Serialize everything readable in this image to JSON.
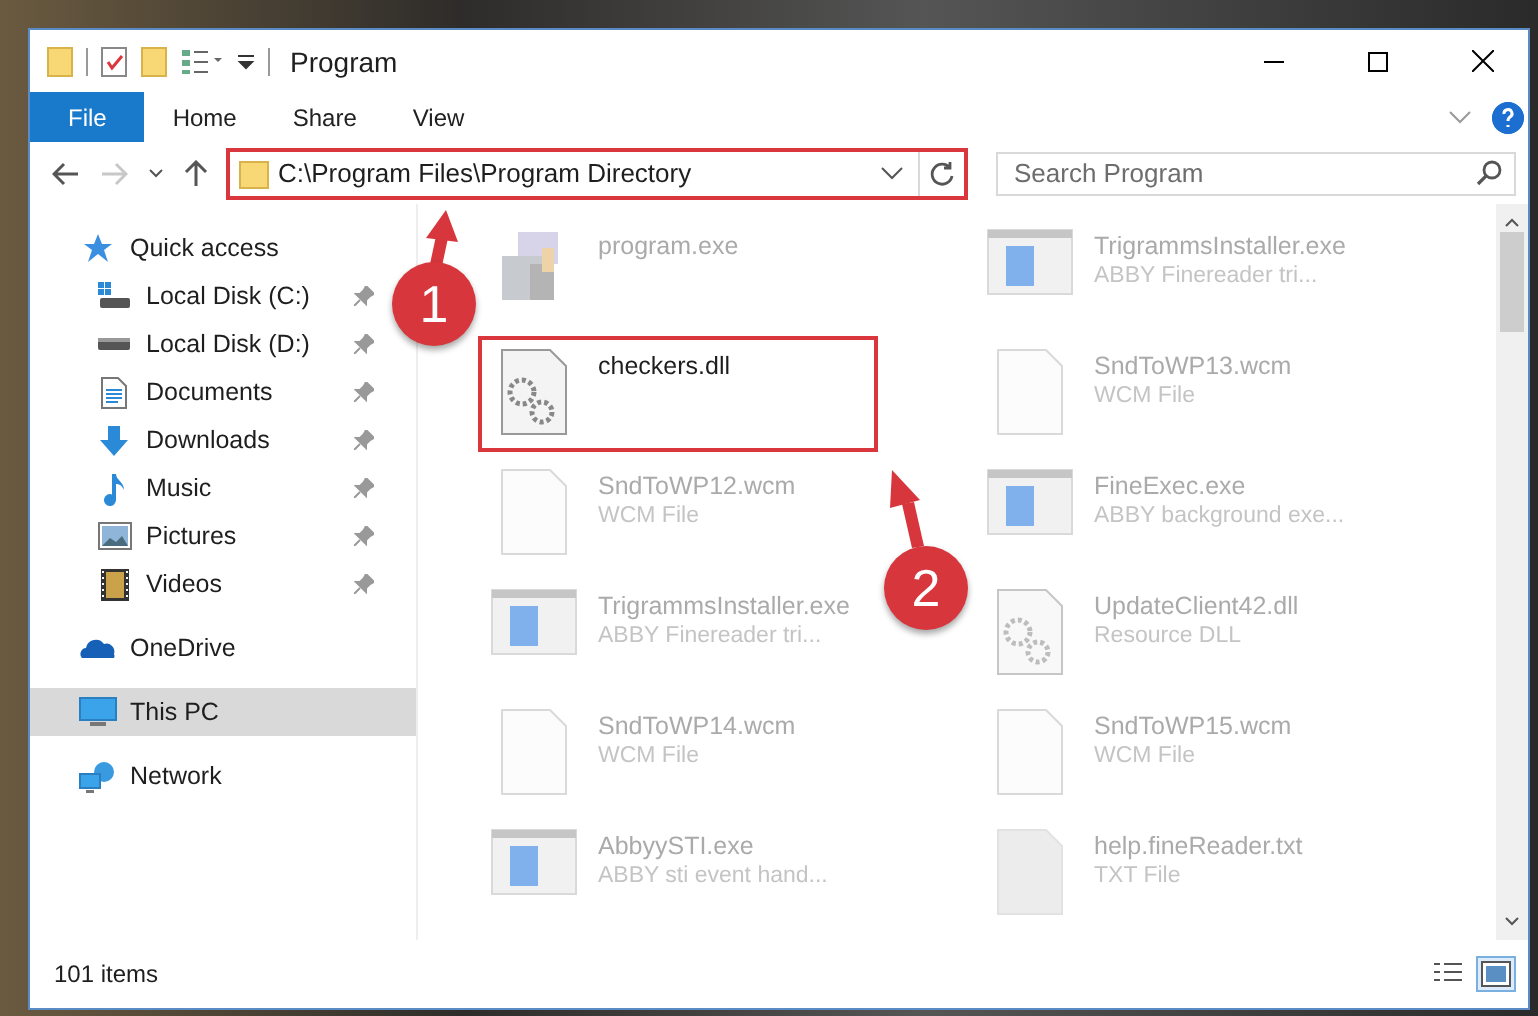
{
  "window": {
    "title": "Program"
  },
  "ribbon_tabs": [
    {
      "label": "File",
      "kind": "file"
    },
    {
      "label": "Home",
      "kind": "tab"
    },
    {
      "label": "Share",
      "kind": "tab"
    },
    {
      "label": "View",
      "kind": "tab"
    }
  ],
  "address_bar": {
    "path": "C:\\Program Files\\Program Directory",
    "highlighted": true
  },
  "search": {
    "placeholder": "Search Program"
  },
  "nav_pane": {
    "items": [
      {
        "label": "Quick access",
        "kind": "star",
        "selected": false,
        "pinned": false,
        "children": [
          {
            "label": "Local Disk (C:)",
            "kind": "system-drive",
            "selected": false,
            "pinned": true
          },
          {
            "label": "Local Disk (D:)",
            "kind": "drive",
            "selected": false,
            "pinned": true
          },
          {
            "label": "Documents",
            "kind": "documents",
            "selected": false,
            "pinned": true
          },
          {
            "label": "Downloads",
            "kind": "downloads",
            "selected": false,
            "pinned": true
          },
          {
            "label": "Music",
            "kind": "music",
            "selected": false,
            "pinned": true
          },
          {
            "label": "Pictures",
            "kind": "pictures",
            "selected": false,
            "pinned": true
          },
          {
            "label": "Videos",
            "kind": "videos",
            "selected": false,
            "pinned": true
          }
        ]
      },
      {
        "label": "OneDrive",
        "kind": "cloud",
        "selected": false,
        "pinned": false
      },
      {
        "label": "This PC",
        "kind": "pc",
        "selected": true,
        "pinned": false
      },
      {
        "label": "Network",
        "kind": "network",
        "selected": false,
        "pinned": false
      }
    ]
  },
  "files": [
    {
      "name": "program.exe",
      "kind": "program",
      "blurred": true,
      "highlighted": false
    },
    {
      "name": "TrigrammsInstaller.exe",
      "type": "ABBY Finereader tri...",
      "kind": "installer",
      "blurred": true,
      "highlighted": false
    },
    {
      "name": "checkers.dll",
      "kind": "dll",
      "blurred": false,
      "highlighted": true
    },
    {
      "name": "SndToWP13.wcm",
      "type": "WCM File",
      "kind": "document",
      "blurred": true,
      "highlighted": false
    },
    {
      "name": "SndToWP12.wcm",
      "type": "WCM File",
      "kind": "document",
      "blurred": true,
      "highlighted": false
    },
    {
      "name": "FineExec.exe",
      "type": "ABBY background exe...",
      "kind": "installer",
      "blurred": true,
      "highlighted": false
    },
    {
      "name": "TrigrammsInstaller.exe",
      "type": "ABBY Finereader tri...",
      "kind": "installer",
      "blurred": true,
      "highlighted": false
    },
    {
      "name": "UpdateClient42.dll",
      "type": "Resource DLL",
      "kind": "dll",
      "blurred": true,
      "highlighted": false
    },
    {
      "name": "SndToWP14.wcm",
      "type": "WCM File",
      "kind": "document",
      "blurred": true,
      "highlighted": false
    },
    {
      "name": "SndToWP15.wcm",
      "type": "WCM File",
      "kind": "document",
      "blurred": true,
      "highlighted": false
    },
    {
      "name": "AbbyySTI.exe",
      "type": "ABBY sti event hand...",
      "kind": "installer",
      "blurred": true,
      "highlighted": false
    },
    {
      "name": "help.fineReader.txt",
      "type": "TXT File",
      "kind": "text",
      "blurred": true,
      "highlighted": false
    }
  ],
  "annotations": [
    {
      "label": "1"
    },
    {
      "label": "2"
    }
  ],
  "status_bar": {
    "item_count": "101 items"
  },
  "view_buttons": [
    {
      "kind": "details",
      "selected": false
    },
    {
      "kind": "large-icons",
      "selected": true
    }
  ]
}
